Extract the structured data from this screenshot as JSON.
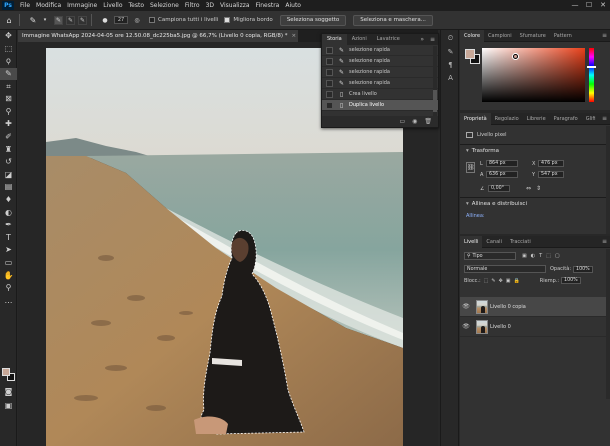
{
  "app": {
    "logo": "Ps"
  },
  "menu": [
    "File",
    "Modifica",
    "Immagine",
    "Livello",
    "Testo",
    "Selezione",
    "Filtro",
    "3D",
    "Visualizza",
    "Finestra",
    "Aiuto"
  ],
  "window_controls": [
    "—",
    "☐",
    "✕"
  ],
  "options_bar": {
    "brush_size": "27",
    "sample_all_layers": "Campiona tutti i livelli",
    "enhance_edge": "Migliora bordo",
    "select_subject_btn": "Seleziona soggetto",
    "select_mask_btn": "Seleziona e maschera..."
  },
  "document": {
    "tab_title": "Immagine WhatsApp 2024-04-05 ore 12.50.08_dc225ba5.jpg @ 66,7% (Livello 0 copia, RGB/8) *",
    "tab_close": "×"
  },
  "history_panel": {
    "tabs": [
      "Storia",
      "Azioni",
      "Lavatrice"
    ],
    "rows": [
      {
        "icon": "quick-selection-icon",
        "label": "selezione rapida"
      },
      {
        "icon": "quick-selection-icon",
        "label": "selezione rapida"
      },
      {
        "icon": "quick-selection-icon",
        "label": "selezione rapida"
      },
      {
        "icon": "quick-selection-icon",
        "label": "selezione rapida"
      },
      {
        "icon": "document-icon",
        "label": "Crea livello"
      },
      {
        "icon": "document-icon",
        "label": "Duplica livello",
        "selected": true
      }
    ]
  },
  "color_panel": {
    "tabs": [
      "Colore",
      "Campioni",
      "Sfumature",
      "Pattern"
    ],
    "foreground": "#c8a898",
    "background": "#111111"
  },
  "properties_panel": {
    "tabs": [
      "Proprietà",
      "Regolazio",
      "Librerie",
      "Paragrafo",
      "Glifi"
    ],
    "layer_type": "Livello pixel",
    "transform_title": "Trasforma",
    "w_label": "L",
    "w_value": "864 px",
    "x_label": "X",
    "x_value": "476 px",
    "h_label": "A",
    "h_value": "636 px",
    "y_label": "Y",
    "y_value": "547 px",
    "angle_value": "0,00°",
    "align_title": "Allinea e distribuisci",
    "align_label": "Allinea:"
  },
  "layers_panel": {
    "tabs": [
      "Livelli",
      "Canali",
      "Tracciati"
    ],
    "filter_type": "Tipo",
    "blend_mode": "Normale",
    "opacity_label": "Opacità:",
    "opacity_value": "100%",
    "lock_label": "Blocc.:",
    "fill_label": "Riemp.:",
    "fill_value": "100%",
    "layers": [
      {
        "name": "Livello 0 copia",
        "selected": true
      },
      {
        "name": "Livello 0",
        "selected": false
      }
    ]
  }
}
